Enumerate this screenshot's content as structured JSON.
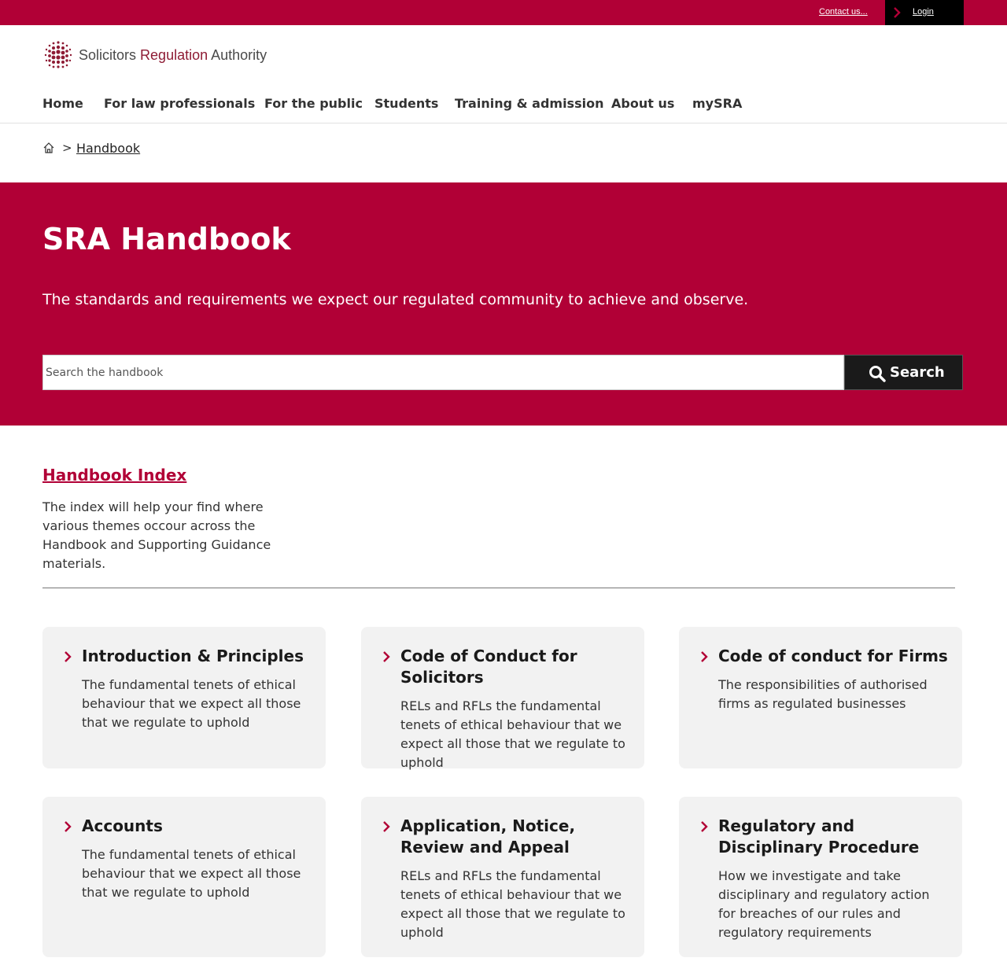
{
  "utility": {
    "contact_label": "Contact us...",
    "login_label": "Login"
  },
  "logo": {
    "word1": "Solicitors",
    "word2": "Regulation",
    "word3": "Authority"
  },
  "nav": {
    "items": [
      {
        "label": "Home"
      },
      {
        "label": "For law professionals"
      },
      {
        "label": "For the public"
      },
      {
        "label": "Students"
      },
      {
        "label": "Training & admission"
      },
      {
        "label": "About us"
      },
      {
        "label": "mySRA"
      }
    ]
  },
  "breadcrumb": {
    "separator": ">",
    "current": "Handbook"
  },
  "hero": {
    "title": "SRA Handbook",
    "subtitle": "The standards and requirements we expect our regulated community to achieve and observe.",
    "search_placeholder": "Search the handbook",
    "search_button": "Search"
  },
  "index": {
    "title": "Handbook Index",
    "description": "The index will help your find where various themes occour across the Handbook and Supporting Guidance materials."
  },
  "cards": [
    {
      "title": "Introduction & Principles",
      "description": "The fundamental tenets of ethical behaviour that we expect all those that we regulate to uphold"
    },
    {
      "title": "Code of Conduct for Solicitors",
      "description": "RELs and RFLs the fundamental tenets of ethical behaviour that we expect all those that we regulate to uphold"
    },
    {
      "title": "Code of conduct for Firms",
      "description": "The responsibilities of authorised firms as regulated businesses"
    },
    {
      "title": "Accounts",
      "description": "The fundamental tenets of ethical behaviour that we expect all those that we regulate to uphold"
    },
    {
      "title": "Application, Notice, Review and Appeal",
      "description": "RELs and RFLs the fundamental tenets of ethical behaviour that we expect all those that we regulate to uphold"
    },
    {
      "title": "Regulatory and Disciplinary Procedure",
      "description": "How we investigate and take disciplinary and regulatory action for breaches of our rules and regulatory requirements"
    }
  ],
  "colors": {
    "brand": "#b10036",
    "dark": "#1a1a1a",
    "card_bg": "#f2f2f2"
  },
  "icons": {
    "login": "chevron-right-icon",
    "breadcrumb_home": "home-icon",
    "search": "search-icon",
    "card": "chevron-right-icon",
    "logo": "dot-grid-logo-icon"
  }
}
